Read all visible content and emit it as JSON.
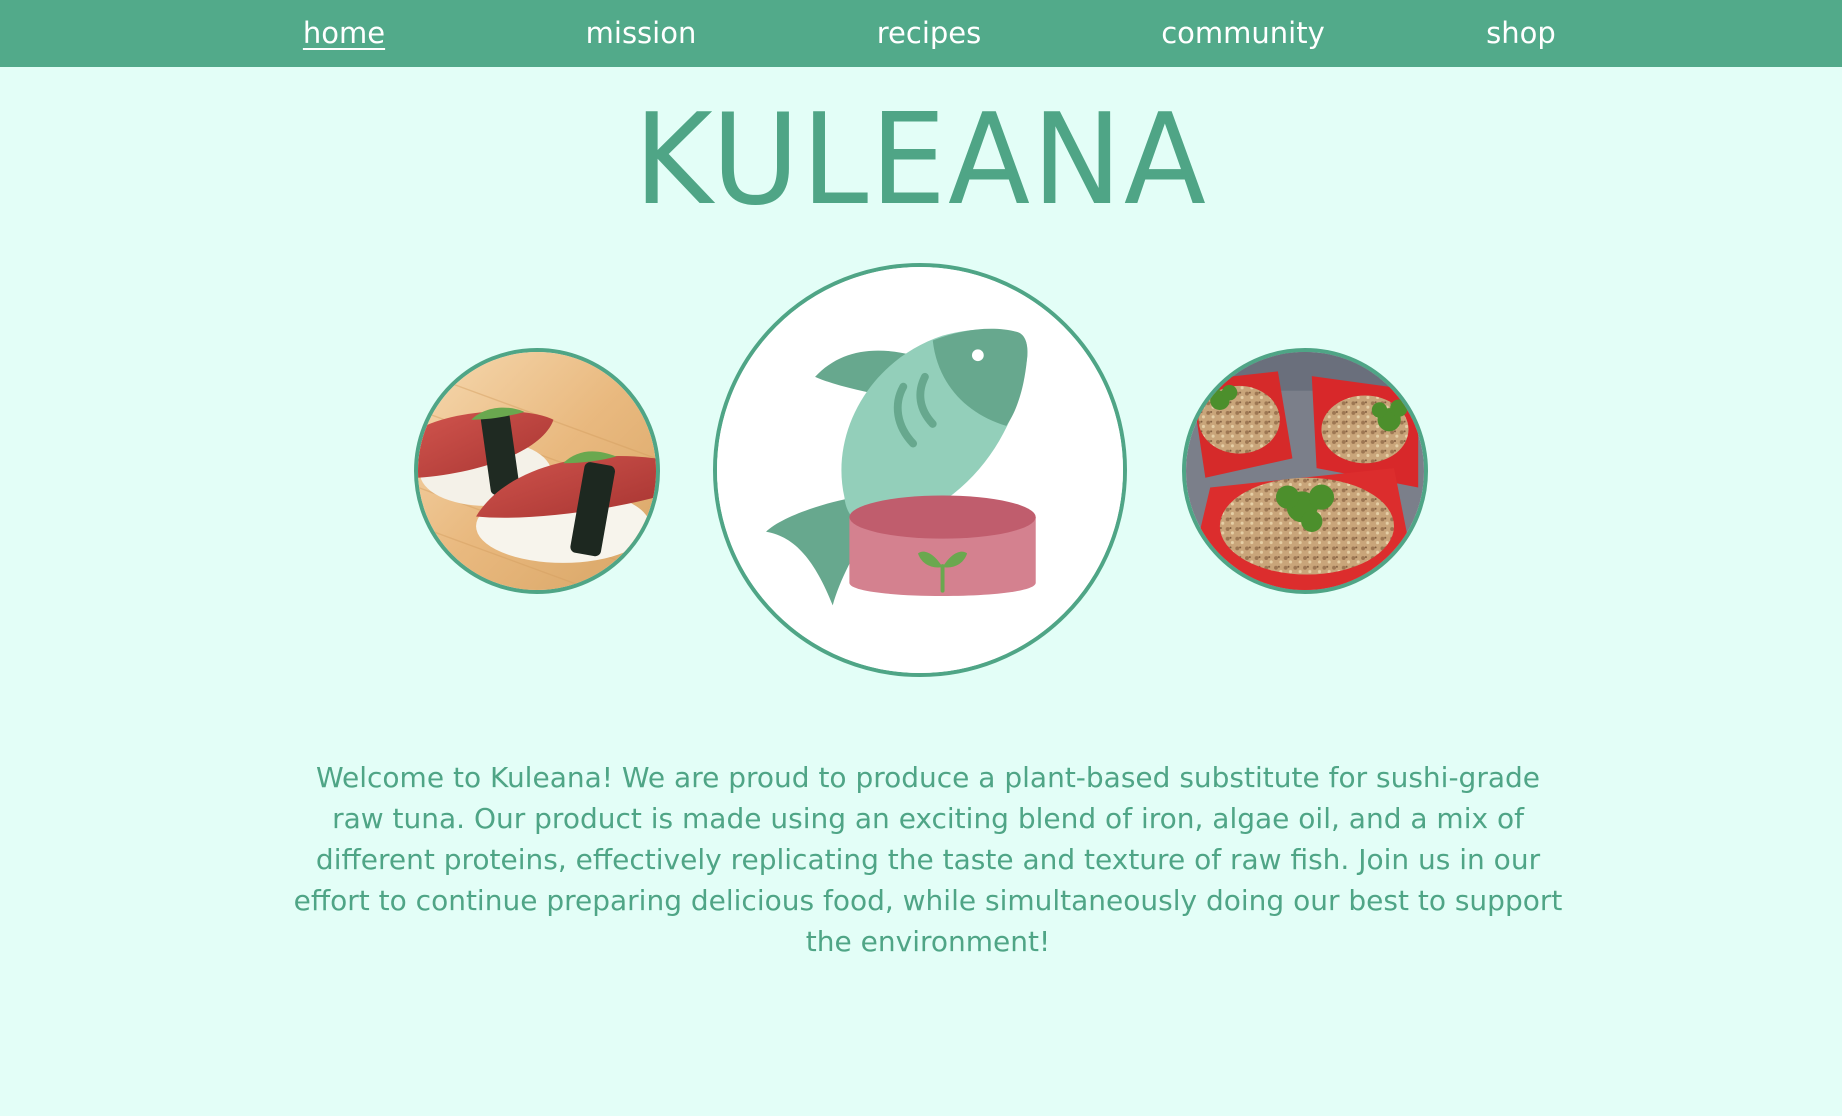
{
  "nav": {
    "items": [
      {
        "label": "home",
        "active": true
      },
      {
        "label": "mission"
      },
      {
        "label": "recipes"
      },
      {
        "label": "community"
      },
      {
        "label": "shop"
      }
    ]
  },
  "hero": {
    "logo": "KULEANA"
  },
  "images": [
    {
      "icon": "sushi-photo"
    },
    {
      "icon": "plant-based-tuna-can-icon"
    },
    {
      "icon": "stuffed-peppers-photo"
    }
  ],
  "intro": {
    "text": "Welcome to Kuleana! We are proud to produce a plant-based substitute for sushi-grade raw tuna. Our product is made using an exciting blend of iron, algae oil, and a mix of different proteins, effectively replicating the taste and texture of raw fish. Join us in our effort to continue preparing delicious food, while simultaneously doing our best to support the environment!"
  },
  "colors": {
    "background": "#e3fef7",
    "accent": "#52aa8a",
    "text": "#4fa586",
    "nav_text": "#ffffff"
  }
}
